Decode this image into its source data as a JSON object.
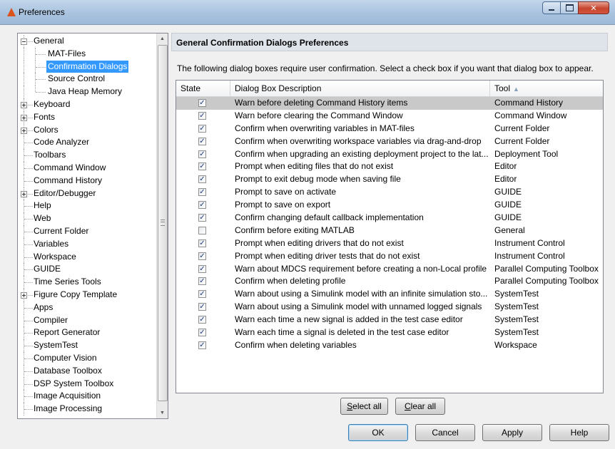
{
  "window": {
    "title": "Preferences"
  },
  "tree": {
    "items": [
      {
        "label": "General",
        "level": 0,
        "expander": "minus"
      },
      {
        "label": "MAT-Files",
        "level": 1,
        "expander": ""
      },
      {
        "label": "Confirmation Dialogs",
        "level": 1,
        "expander": "",
        "selected": true
      },
      {
        "label": "Source Control",
        "level": 1,
        "expander": ""
      },
      {
        "label": "Java Heap Memory",
        "level": 1,
        "expander": ""
      },
      {
        "label": "Keyboard",
        "level": 0,
        "expander": "plus"
      },
      {
        "label": "Fonts",
        "level": 0,
        "expander": "plus"
      },
      {
        "label": "Colors",
        "level": 0,
        "expander": "plus"
      },
      {
        "label": "Code Analyzer",
        "level": 0,
        "expander": ""
      },
      {
        "label": "Toolbars",
        "level": 0,
        "expander": ""
      },
      {
        "label": "Command Window",
        "level": 0,
        "expander": ""
      },
      {
        "label": "Command History",
        "level": 0,
        "expander": ""
      },
      {
        "label": "Editor/Debugger",
        "level": 0,
        "expander": "plus"
      },
      {
        "label": "Help",
        "level": 0,
        "expander": ""
      },
      {
        "label": "Web",
        "level": 0,
        "expander": ""
      },
      {
        "label": "Current Folder",
        "level": 0,
        "expander": ""
      },
      {
        "label": "Variables",
        "level": 0,
        "expander": ""
      },
      {
        "label": "Workspace",
        "level": 0,
        "expander": ""
      },
      {
        "label": "GUIDE",
        "level": 0,
        "expander": ""
      },
      {
        "label": "Time Series Tools",
        "level": 0,
        "expander": ""
      },
      {
        "label": "Figure Copy Template",
        "level": 0,
        "expander": "plus"
      },
      {
        "label": "Apps",
        "level": 0,
        "expander": ""
      },
      {
        "label": "Compiler",
        "level": 0,
        "expander": ""
      },
      {
        "label": "Report Generator",
        "level": 0,
        "expander": ""
      },
      {
        "label": "SystemTest",
        "level": 0,
        "expander": ""
      },
      {
        "label": "Computer Vision",
        "level": 0,
        "expander": ""
      },
      {
        "label": "Database Toolbox",
        "level": 0,
        "expander": ""
      },
      {
        "label": "DSP System Toolbox",
        "level": 0,
        "expander": ""
      },
      {
        "label": "Image Acquisition",
        "level": 0,
        "expander": ""
      },
      {
        "label": "Image Processing",
        "level": 0,
        "expander": ""
      }
    ]
  },
  "panel": {
    "title": "General Confirmation Dialogs Preferences",
    "instructions": "The following dialog boxes require user confirmation.  Select a check box if you want that dialog box to appear."
  },
  "table": {
    "columns": {
      "state": "State",
      "description": "Dialog Box Description",
      "tool": "Tool"
    },
    "sort_indicator": "▲",
    "rows": [
      {
        "checked": true,
        "description": "Warn before deleting Command History items",
        "tool": "Command History",
        "selected": true
      },
      {
        "checked": true,
        "description": "Warn before clearing the Command Window",
        "tool": "Command Window"
      },
      {
        "checked": true,
        "description": "Confirm when overwriting variables in MAT-files",
        "tool": "Current Folder"
      },
      {
        "checked": true,
        "description": "Confirm when overwriting workspace variables via drag-and-drop",
        "tool": "Current Folder"
      },
      {
        "checked": true,
        "description": "Confirm when upgrading an existing deployment project to the lat...",
        "tool": "Deployment Tool"
      },
      {
        "checked": true,
        "description": "Prompt when editing files that do not exist",
        "tool": "Editor"
      },
      {
        "checked": true,
        "description": "Prompt to exit debug mode when saving file",
        "tool": "Editor"
      },
      {
        "checked": true,
        "description": "Prompt to save on activate",
        "tool": "GUIDE"
      },
      {
        "checked": true,
        "description": "Prompt to save on export",
        "tool": "GUIDE"
      },
      {
        "checked": true,
        "description": "Confirm changing default callback implementation",
        "tool": "GUIDE"
      },
      {
        "checked": false,
        "description": "Confirm before exiting MATLAB",
        "tool": "General"
      },
      {
        "checked": true,
        "description": "Prompt when editing drivers that do not exist",
        "tool": "Instrument Control"
      },
      {
        "checked": true,
        "description": "Prompt when editing driver tests that do not exist",
        "tool": "Instrument Control"
      },
      {
        "checked": true,
        "description": "Warn about MDCS requirement before creating a non-Local profile",
        "tool": "Parallel Computing Toolbox"
      },
      {
        "checked": true,
        "description": "Confirm when deleting profile",
        "tool": "Parallel Computing Toolbox"
      },
      {
        "checked": true,
        "description": "Warn about using a Simulink model with an infinite simulation sto...",
        "tool": "SystemTest"
      },
      {
        "checked": true,
        "description": "Warn about using a Simulink model with unnamed logged signals",
        "tool": "SystemTest"
      },
      {
        "checked": true,
        "description": "Warn each time a new signal is added in the test case editor",
        "tool": "SystemTest"
      },
      {
        "checked": true,
        "description": "Warn each time a signal is deleted in the test case editor",
        "tool": "SystemTest"
      },
      {
        "checked": true,
        "description": "Confirm when deleting variables",
        "tool": "Workspace"
      }
    ],
    "check_glyph": "✓"
  },
  "buttons": {
    "select_all": {
      "mnemonic": "S",
      "rest": "elect all"
    },
    "clear_all": {
      "mnemonic": "C",
      "rest": "lear all"
    },
    "ok": "OK",
    "cancel": "Cancel",
    "apply": "Apply",
    "help": "Help"
  },
  "colors": {
    "selection": "#3399ff",
    "row_selected": "#c9c9c9",
    "header_bg": "#dfe3ea",
    "close_button": "#c6452f"
  },
  "icons": {
    "window": "matlab-logo-icon",
    "minimize": "minimize-icon",
    "maximize": "maximize-icon",
    "close": "close-icon"
  }
}
